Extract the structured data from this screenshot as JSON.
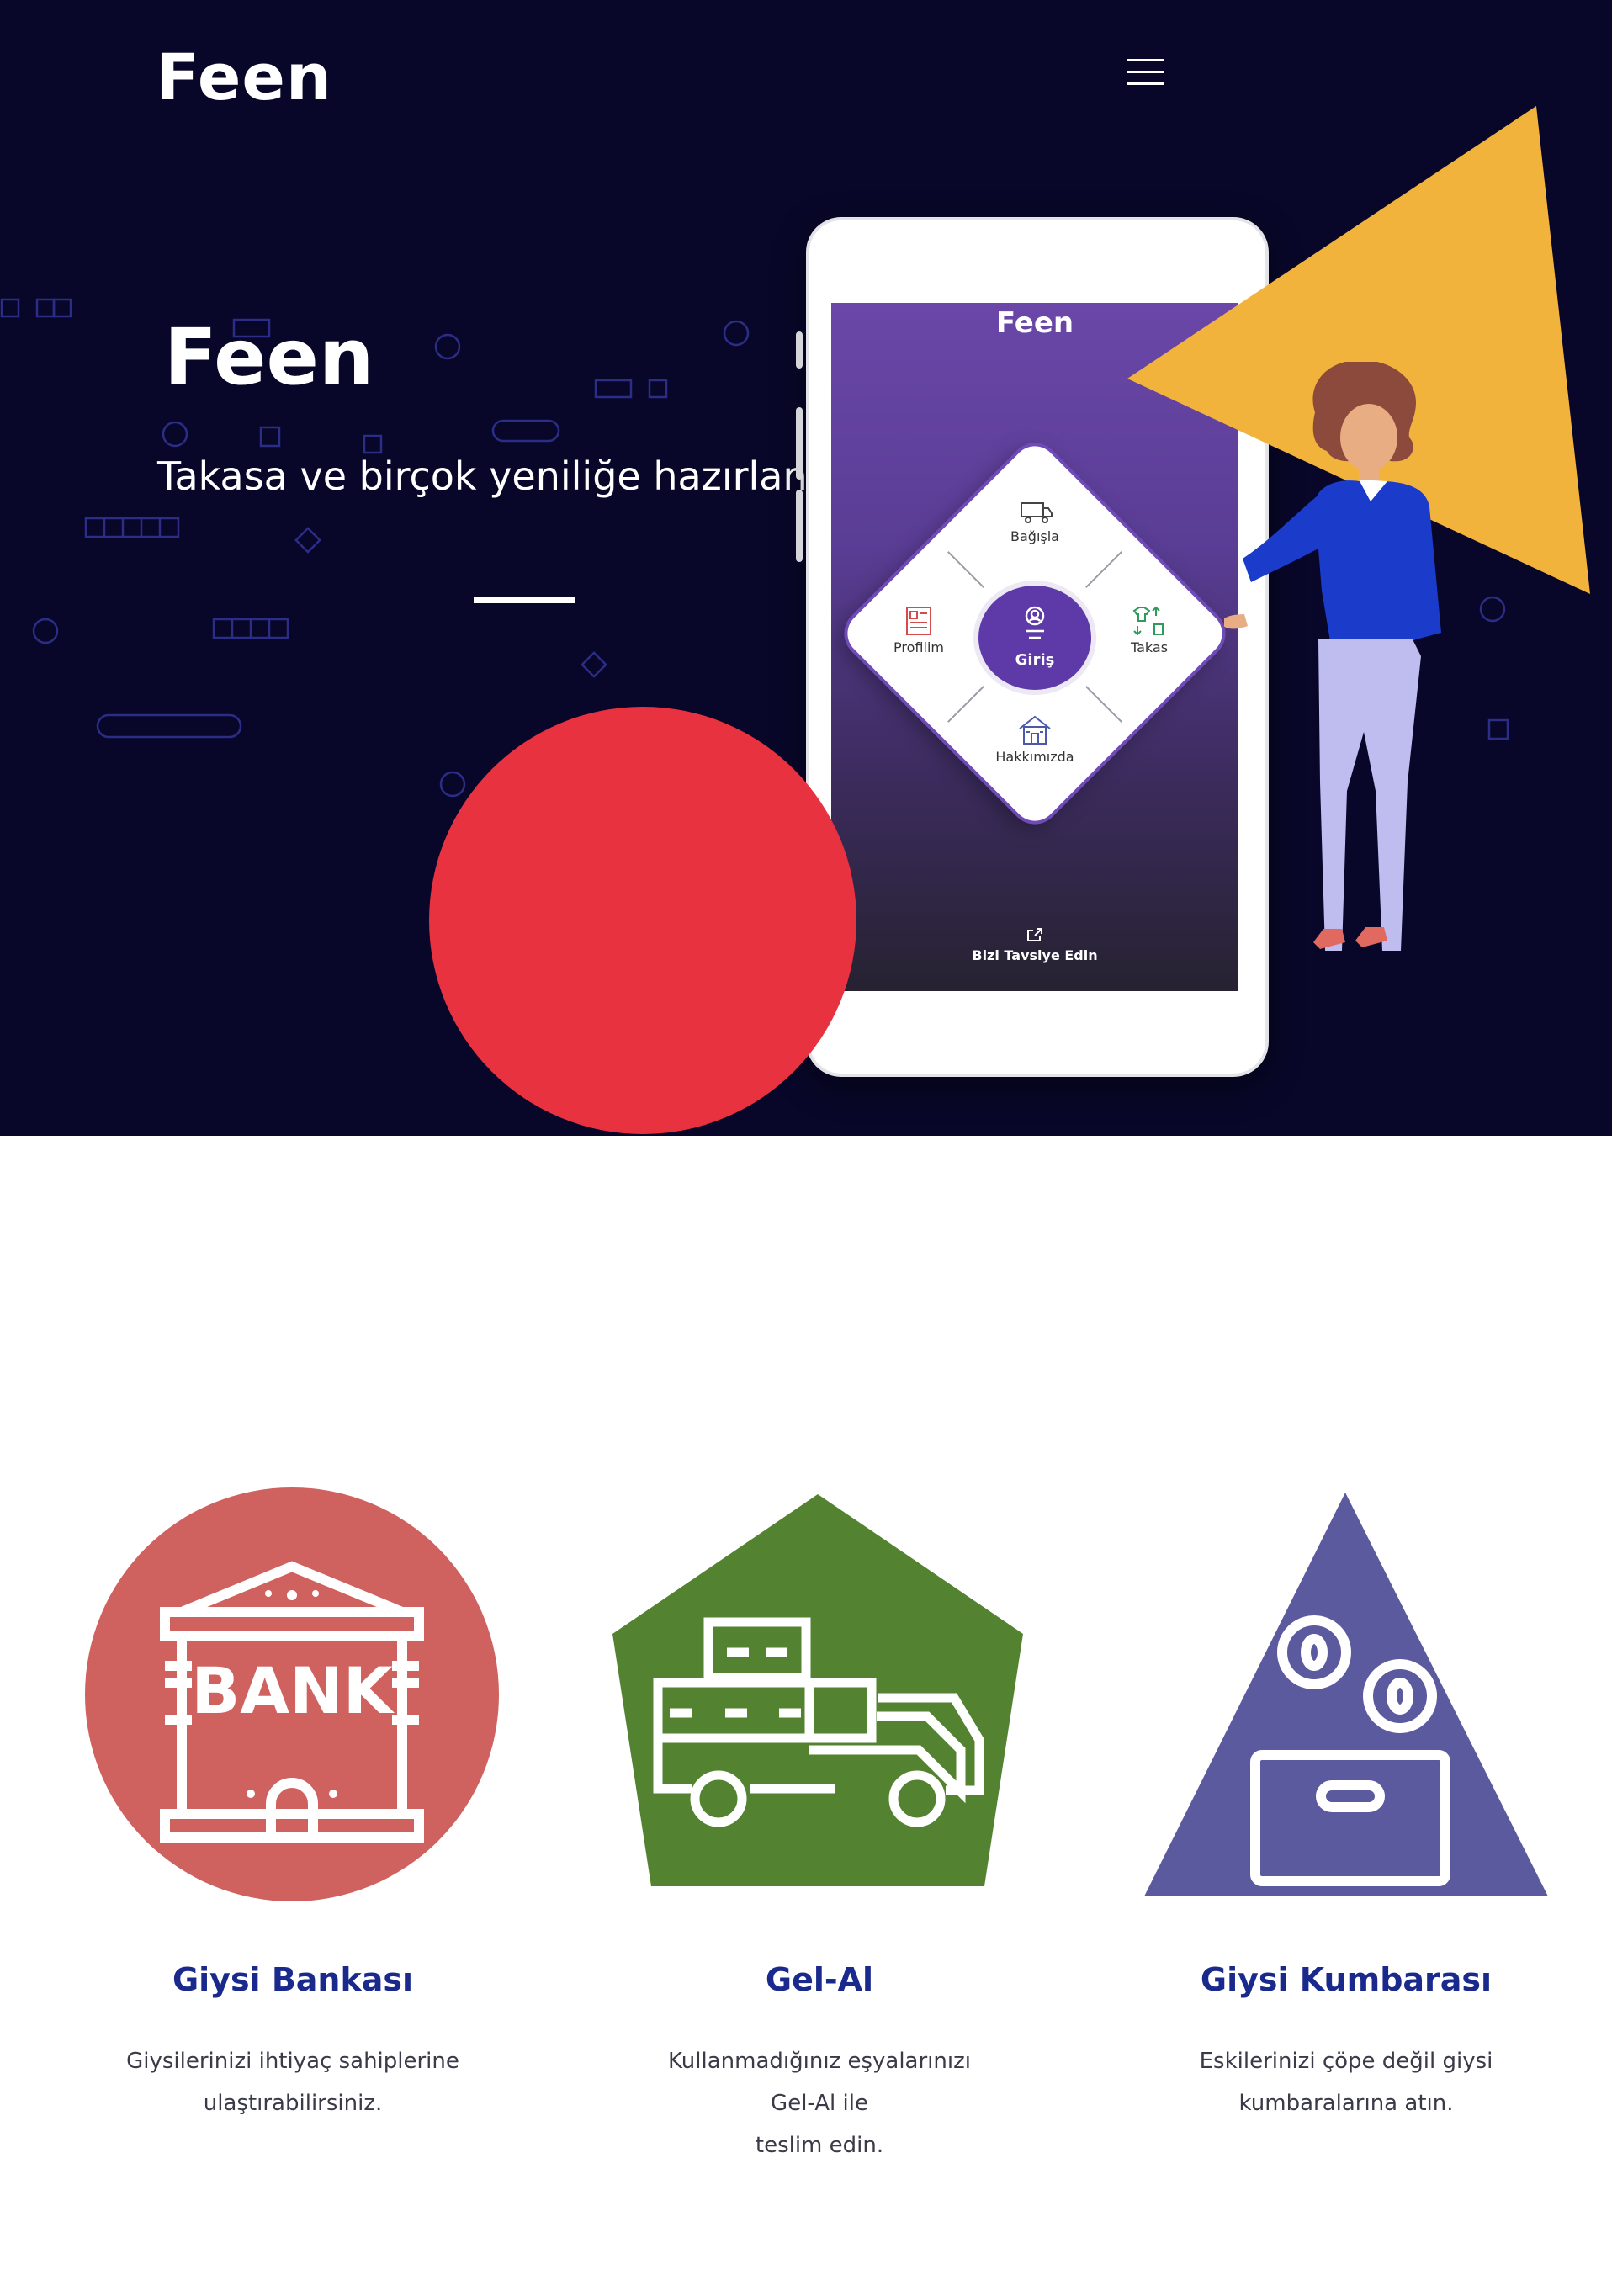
{
  "nav": {
    "logo": "Feen",
    "menu_icon": "hamburger-menu-icon"
  },
  "hero": {
    "title": "Feen",
    "subtitle": "Takasa ve birçok yeniliğe hazırlan!"
  },
  "phone": {
    "app_title": "Feen",
    "menu": {
      "donate": "Bağışla",
      "profile": "Profilim",
      "login": "Giriş",
      "swap": "Takas",
      "about": "Hakkımızda"
    },
    "recommend": "Bizi Tavsiye Edin"
  },
  "colors": {
    "hero_bg": "#080729",
    "triangle": "#f2b33d",
    "circle": "#e83240",
    "bank": "#cf625f",
    "gelal": "#538230",
    "kumbara": "#5b5a9e",
    "heading": "#1a2a8c"
  },
  "features": [
    {
      "icon": "bank-icon",
      "bank_sign": "BANK",
      "title": "Giysi Bankası",
      "desc_line1": "Giysilerinizi ihtiyaç sahiplerine",
      "desc_line2": "ulaştırabilirsiniz."
    },
    {
      "icon": "delivery-truck-icon",
      "title": "Gel-Al",
      "desc_line1": "Kullanmadığınız eşyalarınızı Gel-Al ile",
      "desc_line2": "teslim edin."
    },
    {
      "icon": "piggy-bank-coins-icon",
      "title": "Giysi Kumbarası",
      "desc_line1": "Eskilerinizi çöpe değil giysi",
      "desc_line2": "kumbaralarına atın."
    }
  ]
}
